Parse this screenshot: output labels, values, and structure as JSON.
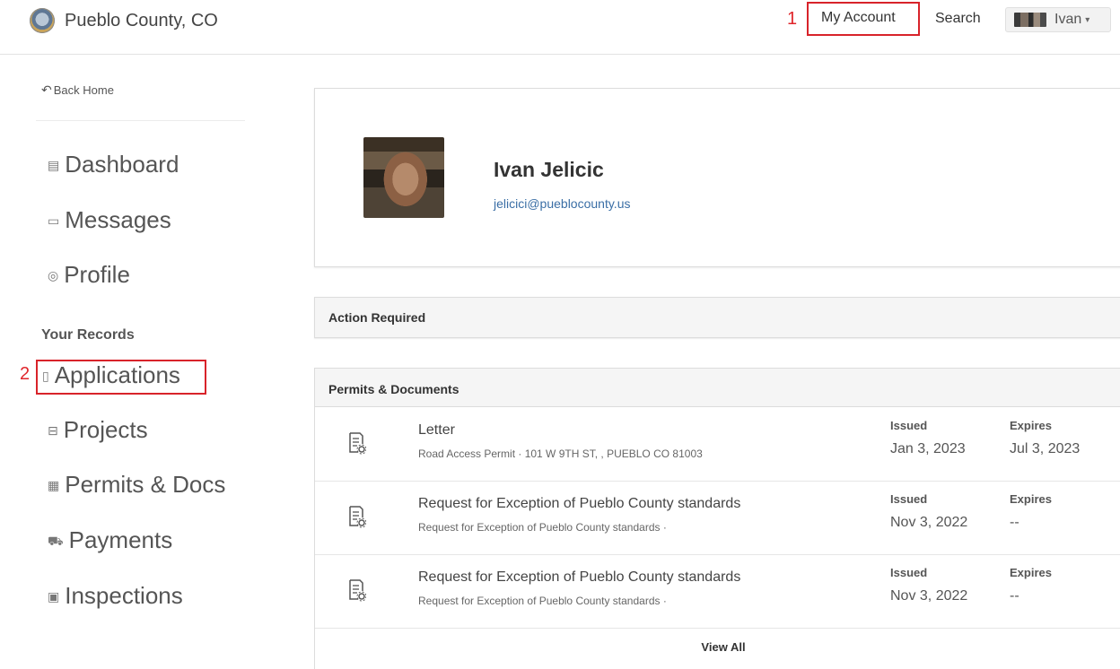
{
  "header": {
    "site_name": "Pueblo County, CO",
    "annotation_1": "1",
    "my_account": "My Account",
    "search": "Search",
    "user_menu": "Ivan"
  },
  "sidebar": {
    "back_home": "Back Home",
    "items": [
      {
        "label": "Dashboard",
        "icon": "dashboard-icon"
      },
      {
        "label": "Messages",
        "icon": "inbox-icon"
      },
      {
        "label": "Profile",
        "icon": "user-circle-icon"
      }
    ],
    "records_title": "Your Records",
    "annotation_2": "2",
    "records": [
      {
        "label": "Applications",
        "icon": "file-icon"
      },
      {
        "label": "Projects",
        "icon": "briefcase-icon"
      },
      {
        "label": "Permits & Docs",
        "icon": "permit-icon"
      },
      {
        "label": "Payments",
        "icon": "cart-icon"
      },
      {
        "label": "Inspections",
        "icon": "clipboard-icon"
      }
    ]
  },
  "profile": {
    "name": "Ivan Jelicic",
    "email": "jelicici@pueblocounty.us"
  },
  "action_required": {
    "title": "Action Required"
  },
  "permits": {
    "title": "Permits & Documents",
    "issued_label": "Issued",
    "expires_label": "Expires",
    "rows": [
      {
        "title": "Letter",
        "subtitle": "Road Access Permit · 101 W 9TH ST, , PUEBLO CO 81003",
        "issued": "Jan 3, 2023",
        "expires": "Jul 3, 2023"
      },
      {
        "title": "Request for Exception of Pueblo County standards",
        "subtitle": "Request for Exception of Pueblo County standards ·",
        "issued": "Nov 3, 2022",
        "expires": "--"
      },
      {
        "title": "Request for Exception of Pueblo County standards",
        "subtitle": "Request for Exception of Pueblo County standards ·",
        "issued": "Nov 3, 2022",
        "expires": "--"
      }
    ],
    "view_all": "View All"
  },
  "colors": {
    "annotation_red": "#d8232a",
    "link_blue": "#3a6ea5",
    "panel_header_bg": "#f5f5f5"
  }
}
